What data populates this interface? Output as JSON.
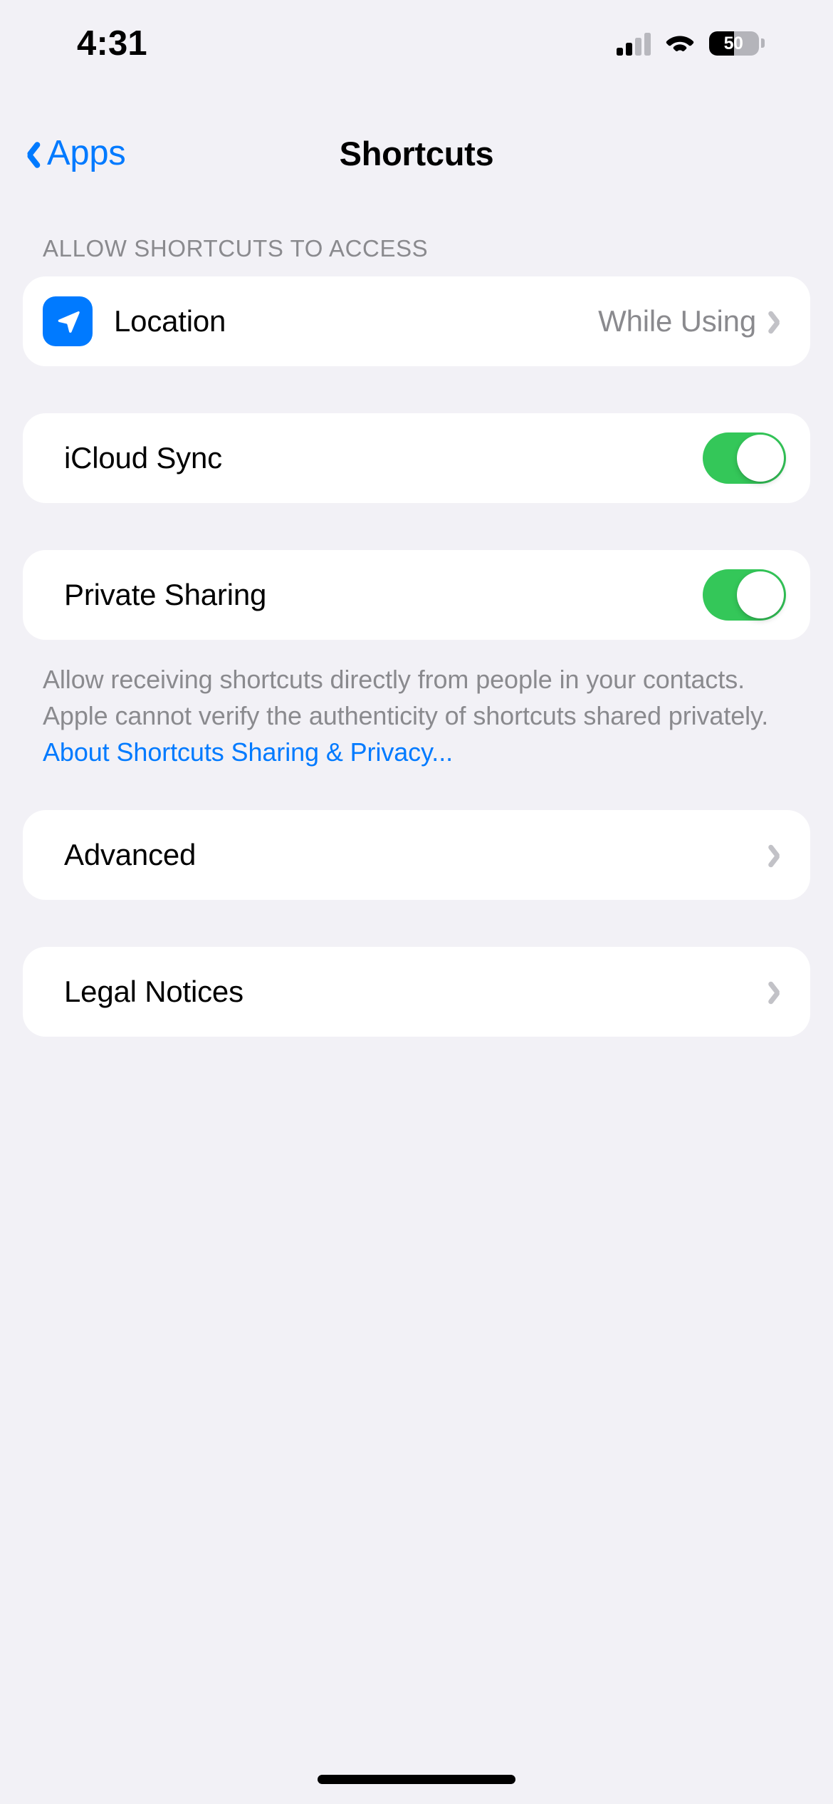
{
  "status_bar": {
    "time": "4:31",
    "cellular_icon": "cellular-bars-icon",
    "wifi_icon": "wifi-icon",
    "battery_percent": "50",
    "battery_level": 50
  },
  "nav": {
    "back_label": "Apps",
    "back_icon": "chevron-left-icon",
    "title": "Shortcuts"
  },
  "sections": {
    "access": {
      "header": "ALLOW SHORTCUTS TO ACCESS",
      "location": {
        "icon": "location-arrow-icon",
        "icon_color": "#007AFF",
        "label": "Location",
        "value": "While Using",
        "chevron": "chevron-right-icon"
      }
    },
    "icloud_sync": {
      "label": "iCloud Sync",
      "toggle_state": "on",
      "toggle_color": "#34C759"
    },
    "private_sharing": {
      "label": "Private Sharing",
      "toggle_state": "on",
      "toggle_color": "#34C759",
      "footnote_text": "Allow receiving shortcuts directly from people in your contacts. Apple cannot verify the authenticity of shortcuts shared privately. ",
      "footnote_link": "About Shortcuts Sharing & Privacy..."
    },
    "advanced": {
      "label": "Advanced",
      "chevron": "chevron-right-icon"
    },
    "legal": {
      "label": "Legal Notices",
      "chevron": "chevron-right-icon"
    }
  },
  "home_indicator": "home-indicator"
}
